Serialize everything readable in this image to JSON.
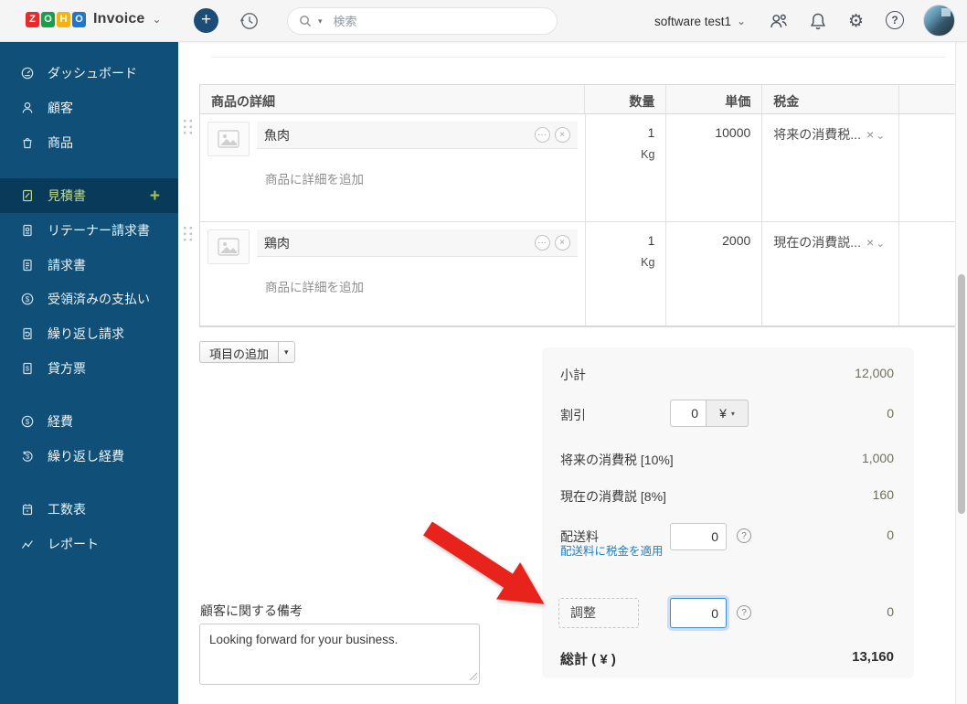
{
  "topbar": {
    "logo_letters": [
      "Z",
      "O",
      "H",
      "O"
    ],
    "logo_product": "Invoice",
    "search_placeholder": "検索",
    "org_name": "software test1"
  },
  "sidebar": {
    "items": [
      {
        "label": "ダッシュボード"
      },
      {
        "label": "顧客"
      },
      {
        "label": "商品"
      },
      {
        "label": "見積書",
        "selected": true
      },
      {
        "label": "リテーナー請求書"
      },
      {
        "label": "請求書"
      },
      {
        "label": "受領済みの支払い"
      },
      {
        "label": "繰り返し請求"
      },
      {
        "label": "貸方票"
      },
      {
        "label": "経費"
      },
      {
        "label": "繰り返し経費"
      },
      {
        "label": "工数表"
      },
      {
        "label": "レポート"
      }
    ]
  },
  "items_table": {
    "headers": {
      "details": "商品の詳細",
      "quantity": "数量",
      "rate": "単価",
      "tax": "税金"
    },
    "rows": [
      {
        "name": "魚肉",
        "add_detail": "商品に詳細を追加",
        "quantity": "1",
        "unit": "Kg",
        "rate": "10000",
        "tax": "将来の消費税..."
      },
      {
        "name": "鶏肉",
        "add_detail": "商品に詳細を追加",
        "quantity": "1",
        "unit": "Kg",
        "rate": "2000",
        "tax": "現在の消費説..."
      }
    ],
    "add_line_label": "項目の追加"
  },
  "summary": {
    "subtotal_label": "小計",
    "subtotal_value": "12,000",
    "discount_label": "割引",
    "discount_input": "0",
    "discount_unit": "¥",
    "discount_value": "0",
    "tax1_label": "将来の消費税 [10%]",
    "tax1_value": "1,000",
    "tax2_label": "現在の消費説 [8%]",
    "tax2_value": "160",
    "shipping_label": "配送料",
    "shipping_link": "配送料に税金を適用",
    "shipping_input": "0",
    "shipping_value": "0",
    "adjustment_label": "調整",
    "adjustment_input": "0",
    "adjustment_value": "0",
    "total_label": "総計 ( ¥ )",
    "total_value": "13,160"
  },
  "notes": {
    "label": "顧客に関する備考",
    "value": "Looking forward for your business."
  },
  "glyphs": {
    "plus": "+",
    "caret": "▾",
    "chevron": "⌄",
    "ellipsis": "···",
    "close": "×",
    "question": "?"
  }
}
